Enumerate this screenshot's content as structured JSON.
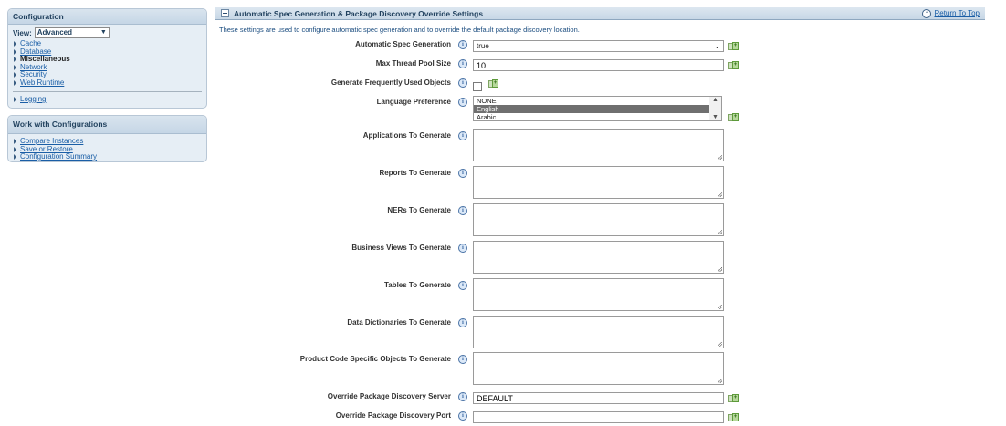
{
  "sidebar": {
    "config_panel": {
      "title": "Configuration",
      "view_label": "View:",
      "view_value": "Advanced",
      "items": [
        {
          "label": "Cache",
          "active": false
        },
        {
          "label": "Database",
          "active": false
        },
        {
          "label": "Miscellaneous",
          "active": true
        },
        {
          "label": "Network",
          "active": false
        },
        {
          "label": "Security",
          "active": false
        },
        {
          "label": "Web Runtime",
          "active": false
        }
      ],
      "logging_label": "Logging"
    },
    "work_panel": {
      "title": "Work with Configurations",
      "items": [
        {
          "label": "Compare Instances"
        },
        {
          "label": "Save or Restore"
        },
        {
          "label": "Configuration Summary"
        }
      ]
    }
  },
  "main": {
    "title": "Automatic Spec Generation & Package Discovery Override Settings",
    "return_label": "Return To Top",
    "description": "These settings are used to configure automatic spec generation and to override the default package discovery location.",
    "fields": {
      "auto_spec": {
        "label": "Automatic Spec Generation",
        "value": "true"
      },
      "max_thread": {
        "label": "Max Thread Pool Size",
        "value": "10"
      },
      "gen_frequent": {
        "label": "Generate Frequently Used Objects",
        "checked": false
      },
      "language": {
        "label": "Language Preference",
        "options": [
          "NONE",
          "English",
          "Arabic"
        ],
        "selected": "English"
      },
      "applications": {
        "label": "Applications To Generate",
        "value": ""
      },
      "reports": {
        "label": "Reports To Generate",
        "value": ""
      },
      "ners": {
        "label": "NERs To Generate",
        "value": ""
      },
      "business_views": {
        "label": "Business Views To Generate",
        "value": ""
      },
      "tables": {
        "label": "Tables To Generate",
        "value": ""
      },
      "data_dictionaries": {
        "label": "Data Dictionaries To Generate",
        "value": ""
      },
      "product_code": {
        "label": "Product Code Specific Objects To Generate",
        "value": ""
      },
      "override_server": {
        "label": "Override Package Discovery Server",
        "value": "DEFAULT"
      },
      "override_port": {
        "label": "Override Package Discovery Port",
        "value": ""
      }
    }
  }
}
